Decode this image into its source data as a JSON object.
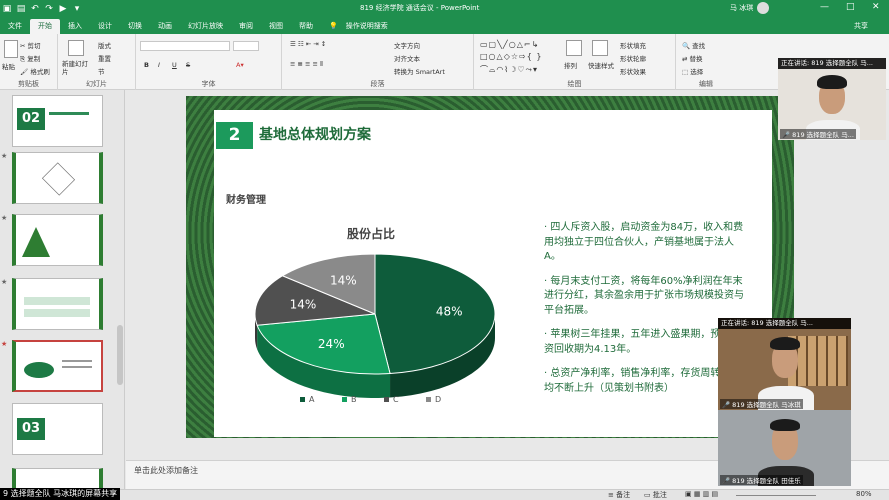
{
  "titlebar": {
    "title": "819 经济学院    通话会议 - PowerPoint",
    "user": "马 冰琪",
    "min": "—",
    "max": "□",
    "close": "✕"
  },
  "tabs": [
    "文件",
    "开始",
    "插入",
    "设计",
    "切换",
    "动画",
    "幻灯片放映",
    "审阅",
    "视图",
    "帮助",
    "操作说明搜索"
  ],
  "share_label": "共享",
  "ribbon": {
    "clipboard": {
      "paste": "粘贴",
      "cut": "剪切",
      "copy": "复制",
      "painter": "格式刷",
      "label": "剪贴板"
    },
    "slides": {
      "new_slide": "新建幻灯片",
      "layout": "版式",
      "reset": "重置",
      "section": "节",
      "label": "幻灯片"
    },
    "font": {
      "label": "字体",
      "bold": "B",
      "italic": "I",
      "underline": "U",
      "strike": "S"
    },
    "paragraph": {
      "label": "段落",
      "text_dir": "文字方向",
      "align_text": "对齐文本",
      "smartart": "转换为 SmartArt"
    },
    "drawing": {
      "label": "绘图",
      "arrange": "排列",
      "quick_styles": "快速样式",
      "fill": "形状填充",
      "outline": "形状轮廓",
      "effects": "形状效果"
    },
    "editing": {
      "label": "编辑",
      "find": "查找",
      "replace": "替换",
      "select": "选择"
    }
  },
  "thumbnails": [
    "",
    "",
    "",
    "",
    "",
    "",
    "",
    ""
  ],
  "slide": {
    "number": "2",
    "title": "基地总体规划方案",
    "subheading": "财务管理",
    "bullets": [
      "· 四人斥资入股，启动资金为84万，收入和费用均独立于四位合伙人，产销基地属于法人A。",
      "· 每月末支付工资，将每年60%净利润在年末进行分红，其余盈余用于扩张市场规模投资与平台拓展。",
      "· 苹果树三年挂果，五年进入盛果期，预估投资回收期为4.13年。",
      "· 总资产净利率，销售净利率，存货周转率等均不断上升（见策划书附表）"
    ]
  },
  "chart_data": {
    "type": "pie",
    "title": "股份占比",
    "categories": [
      "A",
      "B",
      "C",
      "D"
    ],
    "values": [
      48,
      24,
      14,
      14
    ],
    "labels": [
      "48%",
      "24%",
      "14%",
      "14%"
    ],
    "colors": [
      "#0e5c3b",
      "#13a060",
      "#505050",
      "#8a8a8a"
    ],
    "legend_position": "bottom"
  },
  "notes_placeholder": "单击此处添加备注",
  "status": {
    "notes": "备注",
    "comments": "批注",
    "zoom": "80%"
  },
  "share_banner": "9 选择题全队 马冰琪的屏幕共享",
  "video": [
    {
      "header": "正在讲话: 819 选择题全队 马...",
      "caption": "819 选择题全队 马..."
    },
    {
      "header": "正在讲话: 819 选择题全队 马...",
      "caption": "819 选择题全队 马冰琪"
    },
    {
      "header": "",
      "caption": "819 选择题全队 田佳乐"
    }
  ]
}
